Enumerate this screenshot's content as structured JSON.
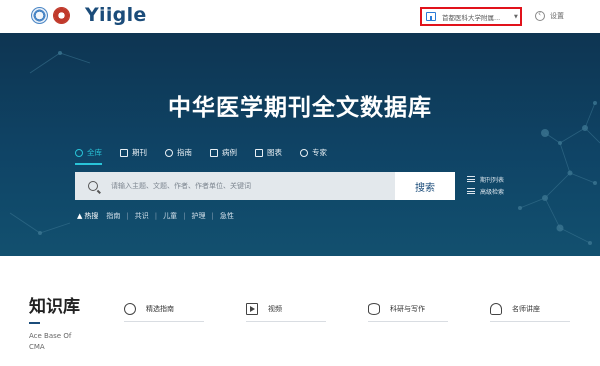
{
  "header": {
    "brand": "Yiigle",
    "institution": "首都医科大学附属...",
    "settings_label": "设置"
  },
  "hero": {
    "title": "中华医学期刊全文数据库",
    "tabs": [
      {
        "label": "全库",
        "icon": "database-icon",
        "active": true
      },
      {
        "label": "期刊",
        "icon": "journal-icon",
        "active": false
      },
      {
        "label": "指南",
        "icon": "compass-icon",
        "active": false
      },
      {
        "label": "病例",
        "icon": "case-icon",
        "active": false
      },
      {
        "label": "图表",
        "icon": "image-icon",
        "active": false
      },
      {
        "label": "专家",
        "icon": "expert-icon",
        "active": false
      }
    ],
    "search": {
      "placeholder": "请输入主题、文题、作者、作者单位、关键词",
      "button": "搜索"
    },
    "side_links": [
      "期刊列表",
      "高级检索"
    ],
    "hot": {
      "label": "热搜",
      "items": [
        "指南",
        "共识",
        "儿童",
        "护理",
        "急性"
      ]
    }
  },
  "knowledge": {
    "title": "知识库",
    "subtitle": "Ace Base Of CMA",
    "cards": [
      {
        "label": "精选指南",
        "icon": "guide-icon"
      },
      {
        "label": "视频",
        "icon": "video-icon"
      },
      {
        "label": "科研与写作",
        "icon": "atom-icon"
      },
      {
        "label": "名师讲座",
        "icon": "lecture-icon"
      }
    ]
  },
  "colors": {
    "brand": "#1b4c7a",
    "accent": "#29c4d8",
    "highlight_border": "#e1121b",
    "hero_bg": "#0f4466"
  }
}
